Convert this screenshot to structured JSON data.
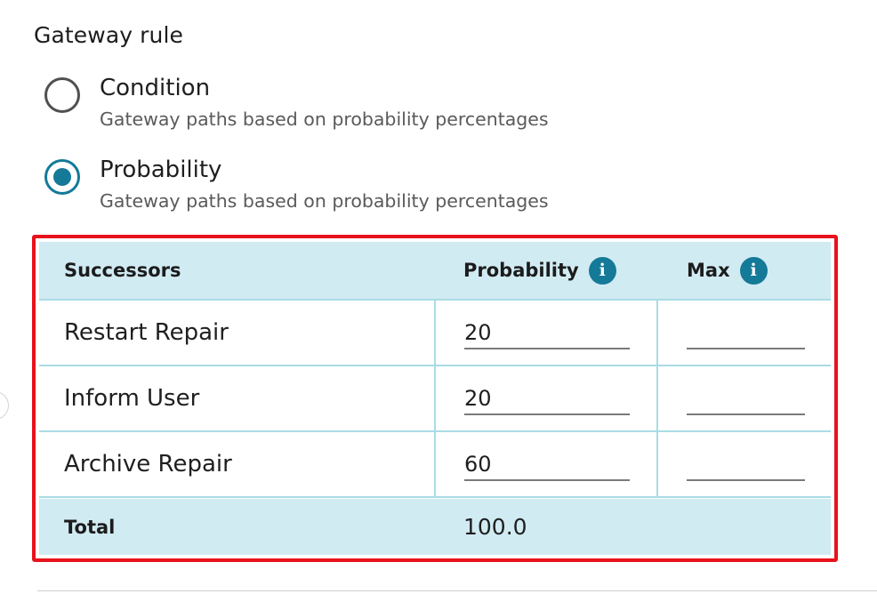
{
  "gateway_rule": {
    "title": "Gateway rule",
    "options": [
      {
        "label": "Condition",
        "description": "Gateway paths based on probability percentages",
        "selected": false
      },
      {
        "label": "Probability",
        "description": "Gateway paths based on probability percentages",
        "selected": true
      }
    ]
  },
  "table": {
    "headers": {
      "successors": "Successors",
      "probability": "Probability",
      "max": "Max"
    },
    "info_icon_glyph": "i",
    "rows": [
      {
        "successor": "Restart Repair",
        "probability": "20",
        "max": ""
      },
      {
        "successor": "Inform User",
        "probability": "20",
        "max": ""
      },
      {
        "successor": "Archive Repair",
        "probability": "60",
        "max": ""
      }
    ],
    "total_label": "Total",
    "total_value": "100.0"
  },
  "colors": {
    "accent": "#147a98",
    "highlight_border": "#e8121c",
    "header_bg": "#d1ebf3",
    "grid_line": "#a9dce5"
  }
}
